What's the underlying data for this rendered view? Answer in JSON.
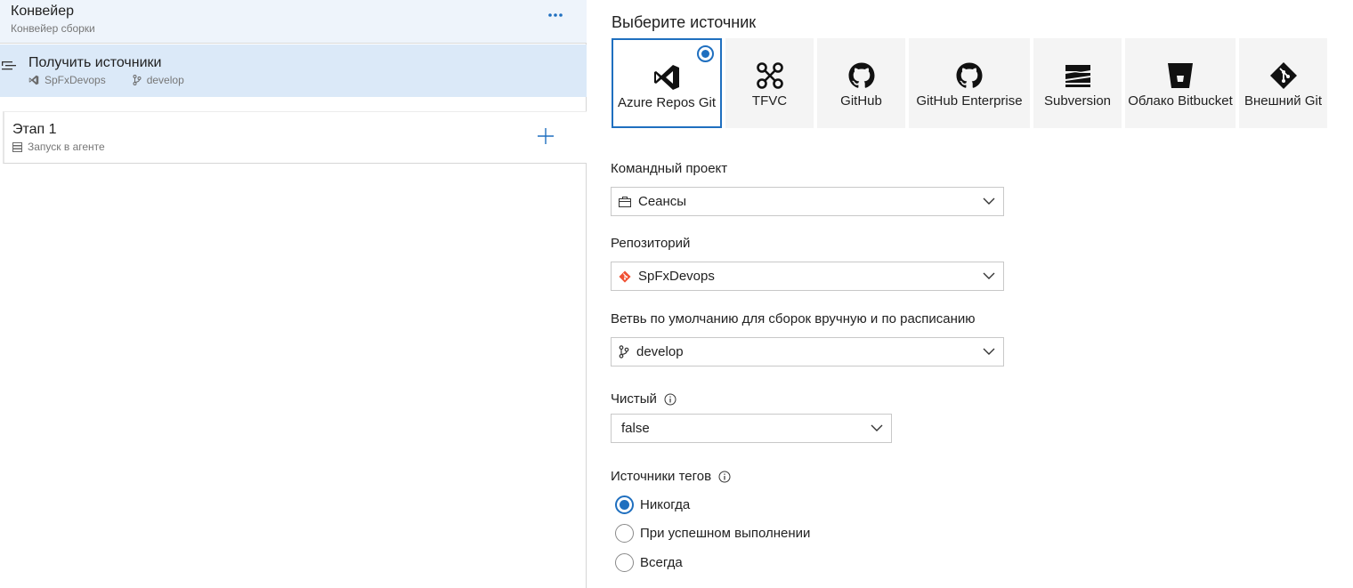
{
  "pipeline": {
    "title": "Конвейер",
    "subtitle": "Конвейер сборки",
    "more_icon": "ellipsis-icon"
  },
  "get_sources": {
    "title": "Получить источники",
    "repo": "SpFxDevops",
    "branch": "develop"
  },
  "stage": {
    "title": "Этап 1",
    "subtitle": "Запуск в агенте"
  },
  "source_picker": {
    "title": "Выберите источник",
    "selected": "Azure Repos Git",
    "options": [
      {
        "label": "Azure Repos Git",
        "icon": "visual-studio-icon"
      },
      {
        "label": "TFVC",
        "icon": "tfvc-icon"
      },
      {
        "label": "GitHub",
        "icon": "github-icon"
      },
      {
        "label": "GitHub Enterprise",
        "icon": "github-enterprise-icon"
      },
      {
        "label": "Subversion",
        "icon": "subversion-icon"
      },
      {
        "label": "Облако Bitbucket",
        "icon": "bitbucket-icon"
      },
      {
        "label": "Внешний Git",
        "icon": "git-icon"
      }
    ]
  },
  "form": {
    "team_project_label": "Командный проект",
    "team_project_value": "Сеансы",
    "repository_label": "Репозиторий",
    "repository_value": "SpFxDevops",
    "branch_label": "Ветвь по умолчанию для сборок вручную и по расписанию",
    "branch_value": "develop",
    "clean_label": "Чистый",
    "clean_value": "false",
    "tag_sources_label": "Источники тегов",
    "tag_options": [
      {
        "label": "Никогда",
        "checked": true
      },
      {
        "label": "При успешном выполнении",
        "checked": false
      },
      {
        "label": "Всегда",
        "checked": false
      }
    ]
  },
  "colors": {
    "accent": "#1f6fbf",
    "selected_row": "#dbe9f8",
    "header_bg": "#eef4fb",
    "git_orange": "#f05133"
  }
}
